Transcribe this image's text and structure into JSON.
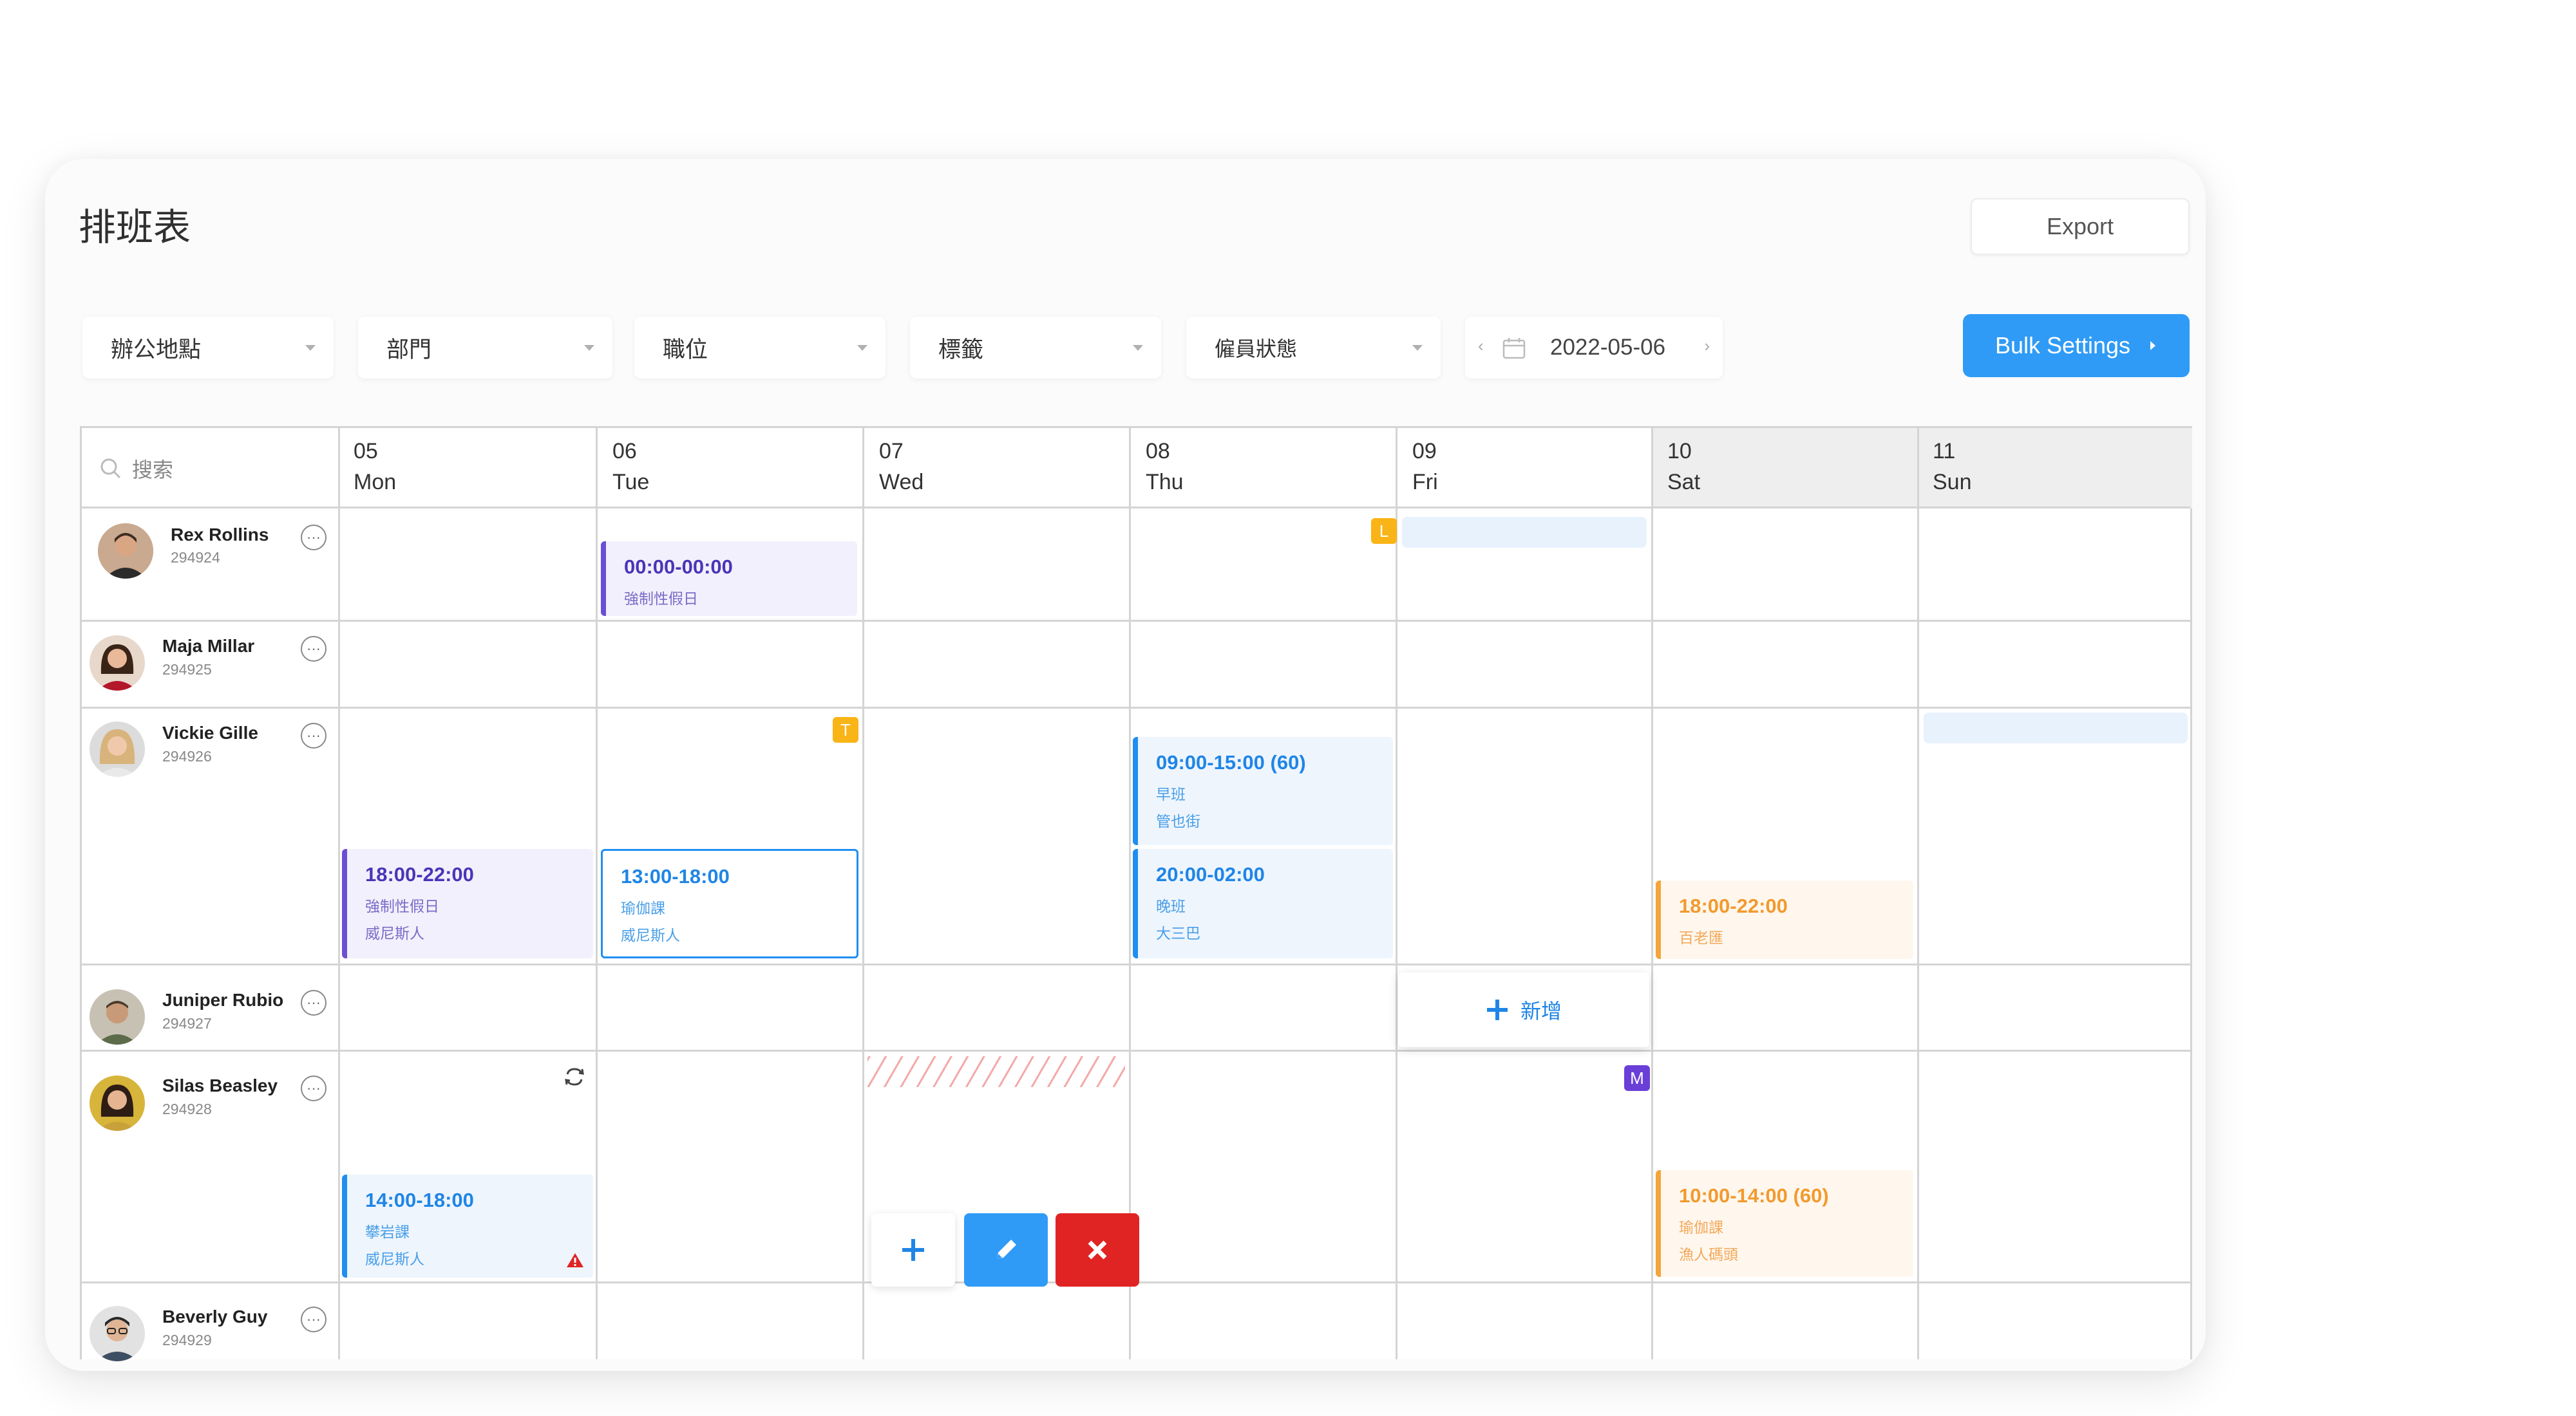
{
  "page_title": "排班表",
  "export_label": "Export",
  "bulk_settings_label": "Bulk Settings",
  "filters": [
    "辦公地點",
    "部門",
    "職位",
    "標籤",
    "僱員狀態"
  ],
  "date_value": "2022-05-06",
  "search_placeholder": "搜索",
  "days": [
    {
      "num": "05",
      "name": "Mon"
    },
    {
      "num": "06",
      "name": "Tue"
    },
    {
      "num": "07",
      "name": "Wed"
    },
    {
      "num": "08",
      "name": "Thu"
    },
    {
      "num": "09",
      "name": "Fri"
    },
    {
      "num": "10",
      "name": "Sat"
    },
    {
      "num": "11",
      "name": "Sun"
    }
  ],
  "employees": [
    {
      "name": "Rex Rollins",
      "id": "294924"
    },
    {
      "name": "Maja Millar",
      "id": "294925"
    },
    {
      "name": "Vickie Gille",
      "id": "294926"
    },
    {
      "name": "Juniper Rubio",
      "id": "294927"
    },
    {
      "name": "Silas Beasley",
      "id": "294928"
    },
    {
      "name": "Beverly Guy",
      "id": "294929"
    }
  ],
  "more_glyph": "···",
  "shifts": {
    "rex_tue": {
      "time": "00:00-00:00",
      "l1": "強制性假日"
    },
    "vickie_mon": {
      "time": "18:00-22:00",
      "l1": "強制性假日",
      "l2": "威尼斯人"
    },
    "vickie_tue": {
      "time": "13:00-18:00",
      "l1": "瑜伽課",
      "l2": "威尼斯人"
    },
    "vickie_thu_a": {
      "time": "09:00-15:00 (60)",
      "l1": "早班",
      "l2": "管也街"
    },
    "vickie_thu_b": {
      "time": "20:00-02:00",
      "l1": "晚班",
      "l2": "大三巴"
    },
    "vickie_sat": {
      "time": "18:00-22:00",
      "l1": "百老匯"
    },
    "silas_mon": {
      "time": "14:00-18:00",
      "l1": "攀岩課",
      "l2": "威尼斯人"
    },
    "silas_sat": {
      "time": "10:00-14:00 (60)",
      "l1": "瑜伽課",
      "l2": "漁人碼頭"
    }
  },
  "badges": {
    "rex_thu": "L",
    "vickie_tue": "T",
    "silas_fri": "M"
  },
  "add_label": "新增",
  "colors": {
    "primary_blue": "#2f9bf6",
    "purple": "#6a4fd6",
    "orange": "#f5a43a",
    "danger_red": "#e02424",
    "badge_yellow": "#f9b417",
    "badge_purple": "#6a3fd8"
  }
}
